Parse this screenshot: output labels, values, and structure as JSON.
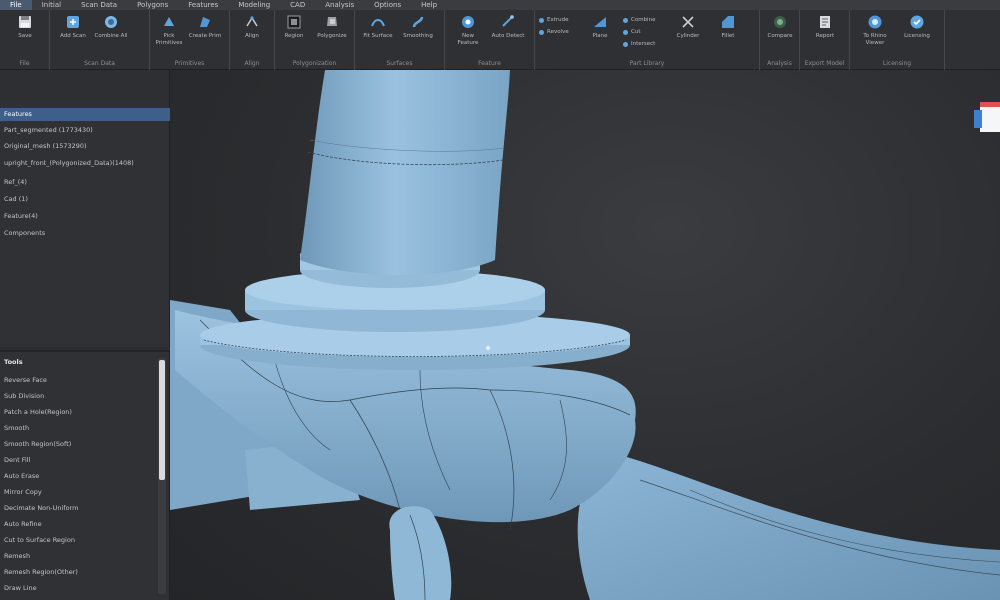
{
  "menu": {
    "items": [
      "File",
      "Initial",
      "Scan Data",
      "Polygons",
      "Features",
      "Modeling",
      "CAD",
      "Analysis",
      "Options",
      "Help"
    ],
    "active_index": 0
  },
  "ribbon": {
    "groups": [
      {
        "label": "File"
      },
      {
        "label": "Scan Data"
      },
      {
        "label": "Primitives"
      },
      {
        "label": "Align"
      },
      {
        "label": "Polygonization"
      },
      {
        "label": "Surfaces"
      },
      {
        "label": "Feature"
      },
      {
        "label": "Part Library"
      },
      {
        "label": "Analysis"
      },
      {
        "label": "Export Model"
      },
      {
        "label": "Licensing"
      }
    ],
    "buttons": [
      {
        "label": "Save"
      },
      {
        "label": "Add Scan"
      },
      {
        "label": "Combine All"
      },
      {
        "label": "Pick Primitives"
      },
      {
        "label": "Create Prim"
      },
      {
        "label": "Align"
      },
      {
        "label": "Region"
      },
      {
        "label": "Polygonize"
      },
      {
        "label": "Fit Surface"
      },
      {
        "label": "Smoothing"
      },
      {
        "label": "New Feature"
      },
      {
        "label": "Auto Detect"
      },
      {
        "label": "Plane"
      },
      {
        "label": "Cylinder"
      },
      {
        "label": "Fillet"
      },
      {
        "label": "Compare"
      },
      {
        "label": "Report"
      },
      {
        "label": "To Rhino Viewer"
      },
      {
        "label": "Licensing"
      }
    ],
    "small_buttons": [
      "Extrude",
      "Revolve",
      "Combine",
      "Cut",
      "Intersect"
    ]
  },
  "tree": {
    "items": [
      "Features",
      "Part_segmented (1773430)",
      "Original_mesh (1573290)",
      "upright_front_(Polygonized_Data)(1408)",
      "Ref_(4)",
      "Cad (1)",
      "Feature(4)",
      "Components"
    ],
    "selected_index": 0
  },
  "properties": {
    "header": "Tools",
    "items": [
      "Reverse Face",
      "Sub Division",
      "Patch a Hole(Region)",
      "Smooth",
      "Smooth Region(Soft)",
      "Dent Fill",
      "Auto Erase",
      "Mirror Copy",
      "Decimate Non-Uniform",
      "Auto Refine",
      "Cut to Surface Region",
      "Remesh",
      "Remesh Region(Other)",
      "Draw Line"
    ]
  },
  "colors": {
    "model": "#8fb8d8",
    "model_shade": "#6f98b8",
    "model_highlight": "#b4d4ea",
    "accent": "#3e5f8a",
    "icon_blue": "#5fa6e0"
  },
  "icons": {
    "save": "floppy-disk-icon",
    "add_scan": "scan-add-icon",
    "primitive": "primitive-shape-icon",
    "align": "align-icon",
    "polygon": "polygon-icon",
    "surface": "surface-icon",
    "feature": "feature-icon",
    "analysis": "analysis-icon",
    "report": "report-icon",
    "license": "license-icon"
  }
}
